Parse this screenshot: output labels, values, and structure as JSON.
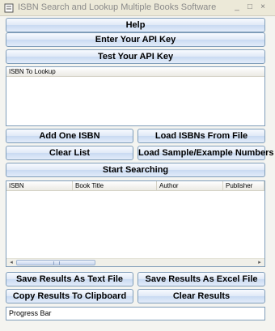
{
  "window": {
    "title": "ISBN Search and Lookup Multiple Books Software",
    "app_icon": "book-app-icon",
    "minimize_glyph": "_",
    "maximize_glyph": "□",
    "close_glyph": "×"
  },
  "buttons": {
    "help": "Help",
    "api_key": "Enter Your API Key",
    "test_api_key": "Test Your API Key",
    "add_one_isbn": "Add One ISBN",
    "load_isbns_file": "Load ISBNs From File",
    "clear_list": "Clear List",
    "load_sample": "Load Sample/Example Numbers",
    "start_searching": "Start Searching",
    "save_text": "Save Results As Text File",
    "save_excel": "Save Results As Excel File",
    "copy_clipboard": "Copy Results To Clipboard",
    "clear_results": "Clear Results"
  },
  "isbn_list": {
    "header": "ISBN To Lookup"
  },
  "results": {
    "columns": [
      "ISBN",
      "Book Title",
      "Author",
      "Publisher"
    ],
    "left_arrow": "◂",
    "right_arrow": "▸"
  },
  "progress": {
    "label": "Progress Bar"
  }
}
